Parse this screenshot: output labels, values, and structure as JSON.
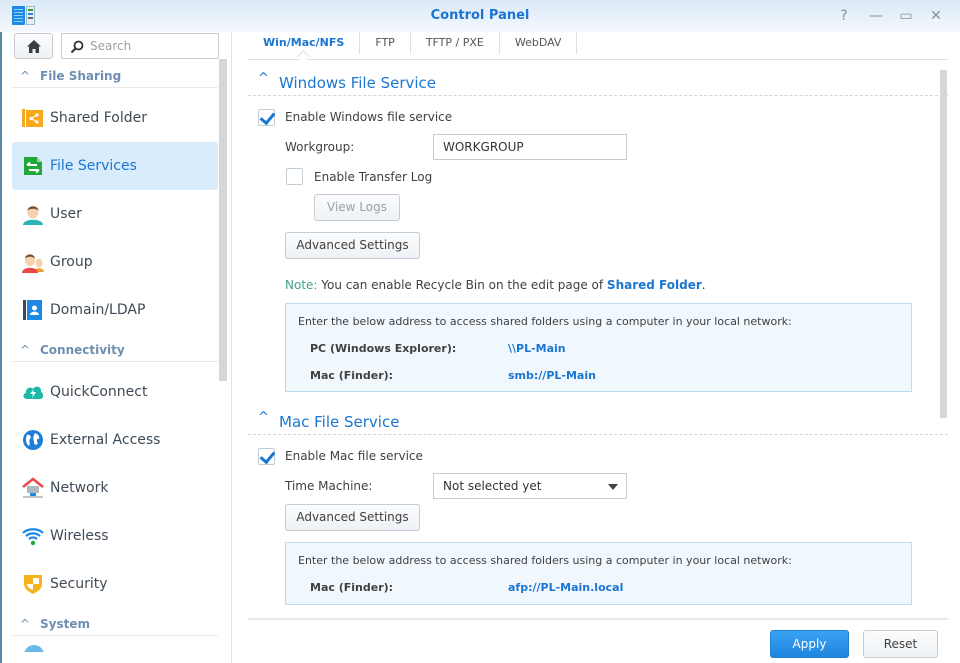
{
  "window": {
    "title": "Control Panel",
    "controls": [
      {
        "name": "help",
        "glyph": "?"
      },
      {
        "name": "minimize",
        "glyph": "—"
      },
      {
        "name": "maximize",
        "glyph": "▭"
      },
      {
        "name": "close",
        "glyph": "✕"
      }
    ]
  },
  "sidebar": {
    "search_placeholder": "Search",
    "groups": [
      {
        "label": "File Sharing",
        "items": [
          {
            "label": "Shared Folder",
            "icon": "shared-folder-icon"
          },
          {
            "label": "File Services",
            "icon": "file-services-icon",
            "active": true
          },
          {
            "label": "User",
            "icon": "user-icon"
          },
          {
            "label": "Group",
            "icon": "group-icon"
          },
          {
            "label": "Domain/LDAP",
            "icon": "domain-ldap-icon"
          }
        ]
      },
      {
        "label": "Connectivity",
        "items": [
          {
            "label": "QuickConnect",
            "icon": "quickconnect-icon"
          },
          {
            "label": "External Access",
            "icon": "external-access-icon"
          },
          {
            "label": "Network",
            "icon": "network-icon"
          },
          {
            "label": "Wireless",
            "icon": "wireless-icon"
          },
          {
            "label": "Security",
            "icon": "security-icon"
          }
        ]
      },
      {
        "label": "System",
        "items": []
      }
    ]
  },
  "tabs": [
    {
      "label": "Win/Mac/NFS",
      "active": true
    },
    {
      "label": "FTP"
    },
    {
      "label": "TFTP / PXE"
    },
    {
      "label": "WebDAV"
    }
  ],
  "windows_service": {
    "title": "Windows File Service",
    "enable_label": "Enable Windows file service",
    "enable_checked": true,
    "workgroup_label": "Workgroup:",
    "workgroup_value": "WORKGROUP",
    "transfer_log_label": "Enable Transfer Log",
    "transfer_log_checked": false,
    "view_logs_label": "View Logs",
    "advanced_label": "Advanced Settings",
    "note_key": "Note:",
    "note_text": " You can enable Recycle Bin on the edit page of ",
    "note_link": "Shared Folder",
    "note_end": ".",
    "info_intro": "Enter the below address to access shared folders using a computer in your local network:",
    "addresses": [
      {
        "label": "PC (Windows Explorer):",
        "value": "\\\\PL-Main"
      },
      {
        "label": "Mac (Finder):",
        "value": "smb://PL-Main"
      }
    ]
  },
  "mac_service": {
    "title": "Mac File Service",
    "enable_label": "Enable Mac file service",
    "enable_checked": true,
    "time_machine_label": "Time Machine:",
    "time_machine_value": "Not selected yet",
    "advanced_label": "Advanced Settings",
    "info_intro": "Enter the below address to access shared folders using a computer in your local network:",
    "addresses": [
      {
        "label": "Mac (Finder):",
        "value": "afp://PL-Main.local"
      }
    ]
  },
  "footer": {
    "apply_label": "Apply",
    "reset_label": "Reset"
  },
  "colors": {
    "accent": "#1a76d2",
    "active_bg": "#d9ecfc",
    "note_green": "#46a08a"
  }
}
